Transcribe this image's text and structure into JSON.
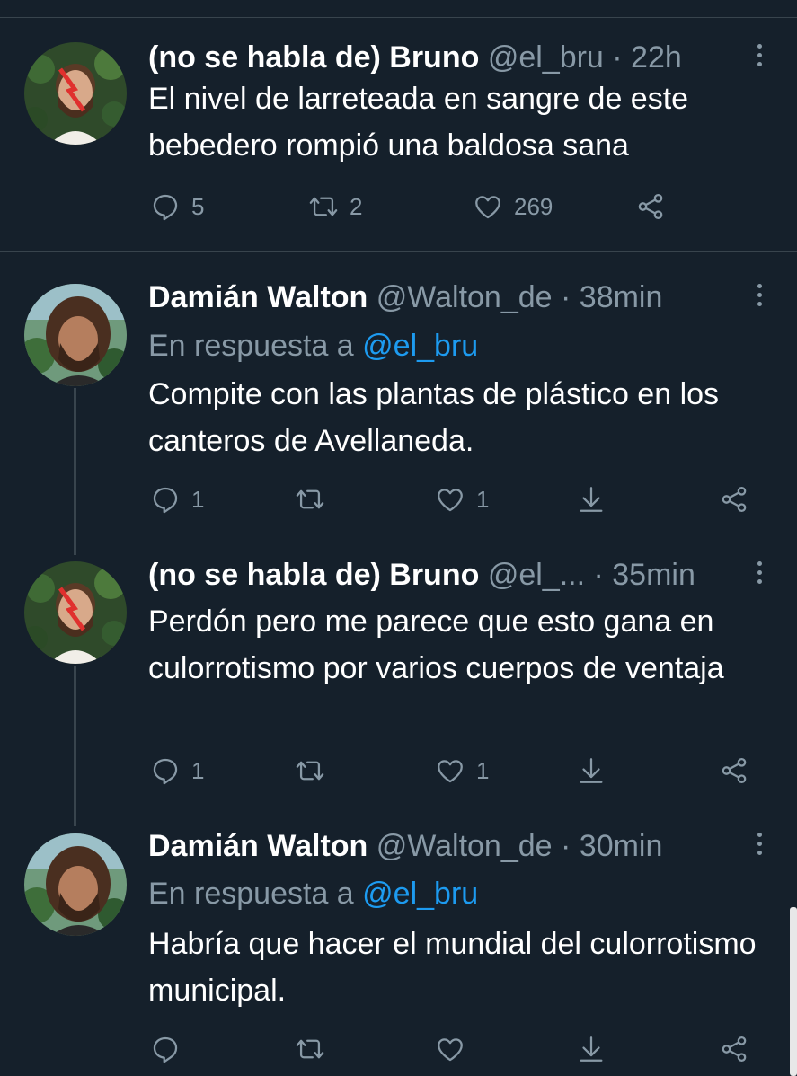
{
  "tweets": [
    {
      "name": "(no se habla de) Bruno",
      "meta": "@el_bru · 22h",
      "text": "El nivel de larreteada en sangre de este bebedero rompió una baldosa sana",
      "reply_count": "5",
      "retweet_count": "2",
      "like_count": "269"
    },
    {
      "name": "Damián Walton",
      "meta": "@Walton_de · 38min",
      "reply_prefix": "En respuesta a",
      "reply_mention": "@el_bru",
      "text": "Compite con las plantas de plástico en los canteros de Avellaneda.",
      "reply_count": "1",
      "like_count": "1"
    },
    {
      "name": "(no se habla de) Bruno",
      "meta": "@el_...  · 35min",
      "text": "Perdón pero me parece que esto gana en culorrotismo por varios cuerpos de ventaja",
      "reply_count": "1",
      "like_count": "1"
    },
    {
      "name": "Damián Walton",
      "meta": "@Walton_de · 30min",
      "reply_prefix": "En respuesta a",
      "reply_mention": "@el_bru",
      "text": "Habría que hacer el mundial del culorrotismo municipal."
    }
  ],
  "icons": {
    "reply": "reply-icon",
    "retweet": "retweet-icon",
    "like": "heart-icon",
    "share": "share-icon",
    "download": "download-icon",
    "more": "more-icon"
  },
  "colors": {
    "background": "#15202b",
    "text": "#ffffff",
    "secondary": "#8899a6",
    "mention": "#1d9bf0",
    "separator": "#38444d"
  }
}
